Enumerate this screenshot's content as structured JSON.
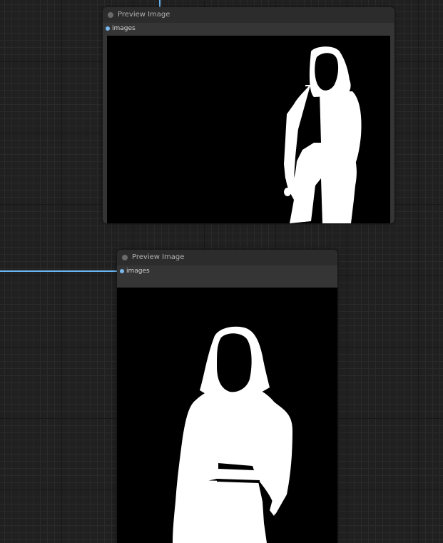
{
  "nodes": [
    {
      "title": "Preview Image",
      "input_label": "images",
      "preview_alt": "white silhouette mask of a person on black background (right side of frame)"
    },
    {
      "title": "Preview Image",
      "input_label": "images",
      "preview_alt": "white silhouette mask of a person on black background (close-up)"
    }
  ],
  "colors": {
    "canvas": "#202020",
    "node_body": "#353535",
    "node_title": "#2c2c2c",
    "link": "#6ab4f0",
    "socket": "#7ab8ee"
  }
}
